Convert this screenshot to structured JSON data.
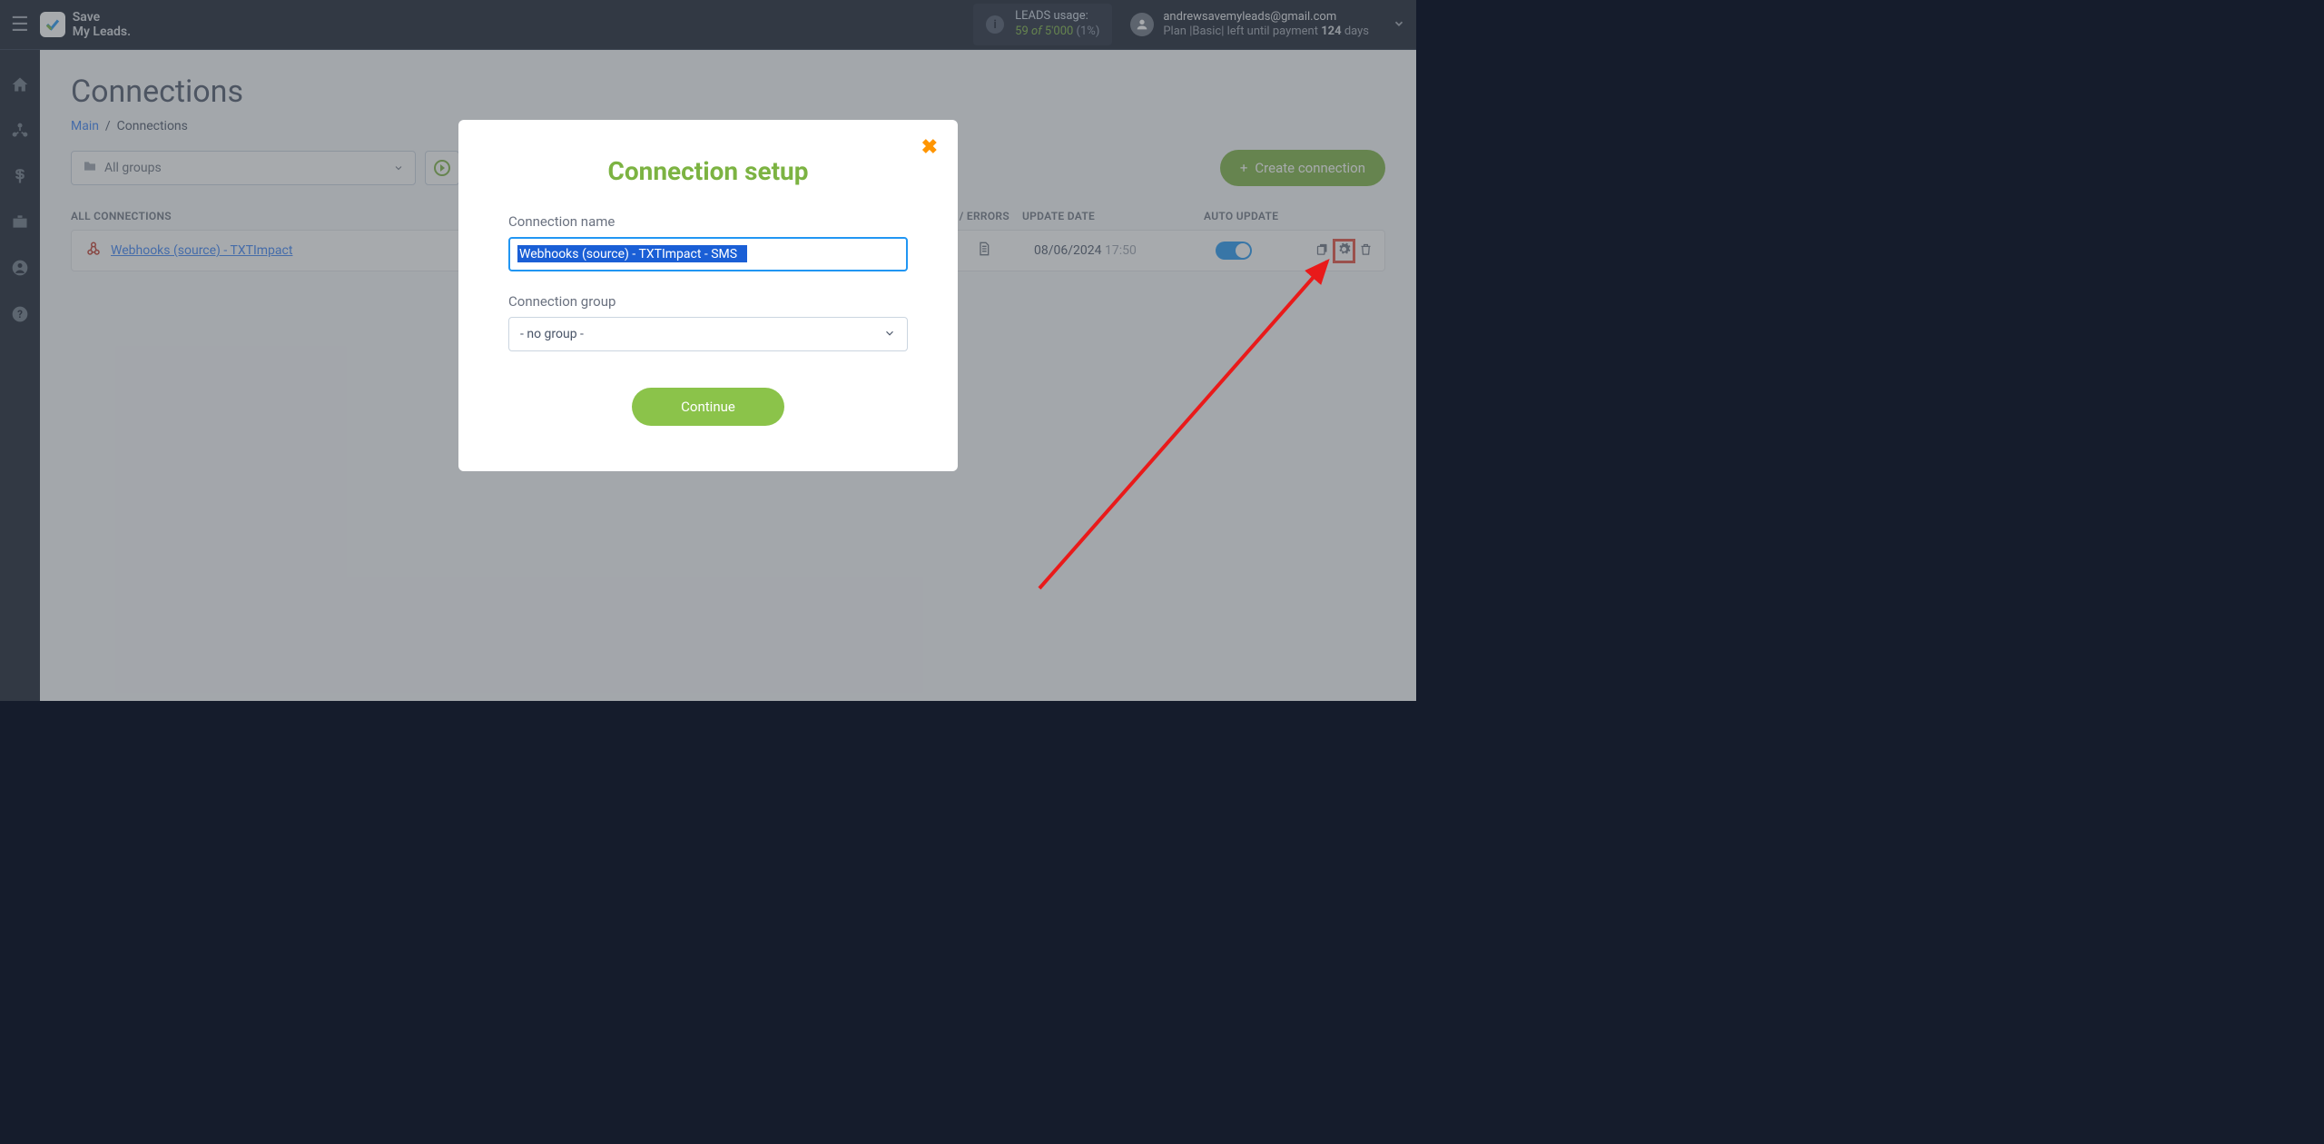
{
  "logo": {
    "line1": "Save",
    "line2": "My Leads."
  },
  "leads": {
    "label": "LEADS usage:",
    "used": "59",
    "of": "of",
    "total": "5'000",
    "pct": "(1%)"
  },
  "user": {
    "email": "andrewsavemyleads@gmail.com",
    "plan_prefix": "Plan |Basic| left until payment ",
    "plan_days": "124",
    "plan_suffix": " days"
  },
  "page": {
    "title": "Connections"
  },
  "breadcrumb": {
    "main": "Main",
    "current": "Connections"
  },
  "toolbar": {
    "groups": "All groups",
    "create": "Create connection"
  },
  "columns": {
    "all": "ALL CONNECTIONS",
    "log": "LOG / ERRORS",
    "date": "UPDATE DATE",
    "auto": "AUTO UPDATE"
  },
  "row": {
    "name": "Webhooks (source) - TXTImpact",
    "date": "08/06/2024",
    "time": "17:50"
  },
  "modal": {
    "title": "Connection setup",
    "name_label": "Connection name",
    "name_value": "Webhooks (source) - TXTImpact - SMS",
    "group_label": "Connection group",
    "group_value": "- no group -",
    "continue": "Continue"
  }
}
